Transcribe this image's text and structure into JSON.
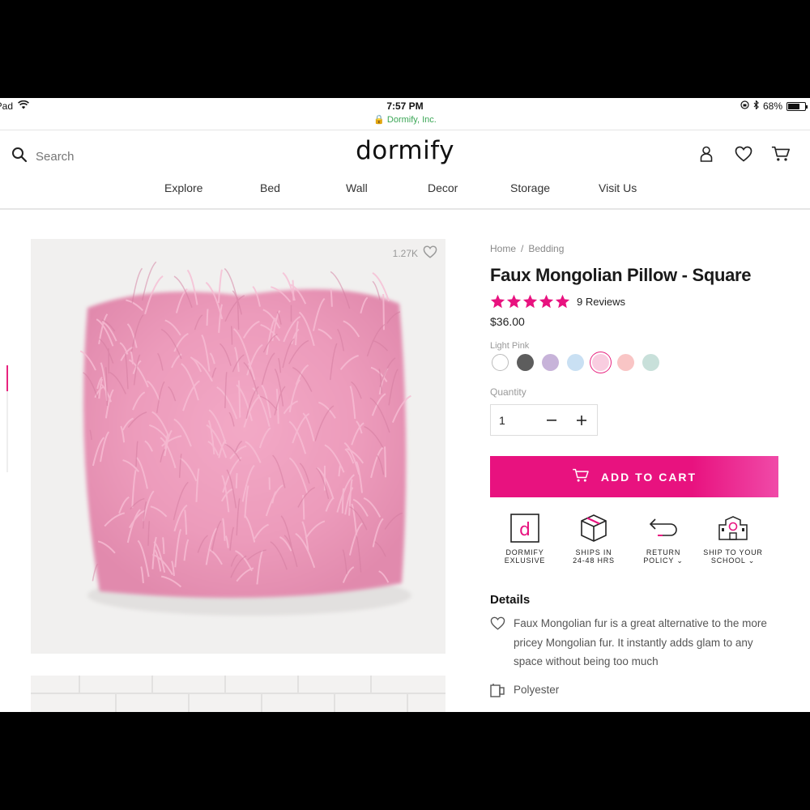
{
  "status_bar": {
    "device": "iPad",
    "time": "7:57 PM",
    "site": "Dormify, Inc.",
    "battery": "68%",
    "battery_level": 0.68
  },
  "header": {
    "search_placeholder": "Search",
    "logo": "dormify",
    "nav": [
      "Explore",
      "Bed",
      "Wall",
      "Decor",
      "Storage",
      "Visit Us"
    ],
    "icons": [
      "account-icon",
      "heart-icon",
      "cart-icon"
    ]
  },
  "gallery": {
    "like_count": "1.27K"
  },
  "product": {
    "breadcrumb": [
      "Home",
      "Bedding"
    ],
    "title": "Faux Mongolian Pillow - Square",
    "rating": 5,
    "reviews": "9 Reviews",
    "price": "$36.00",
    "selected_color": "Light Pink",
    "swatches": [
      "#ffffff",
      "#5d5d5d",
      "#c7b3d9",
      "#c9e0f3",
      "#f9cde0",
      "#f9c5c5",
      "#c8e0da"
    ],
    "swatch_selected_index": 4,
    "quantity_label": "Quantity",
    "quantity": "1",
    "add_to_cart": "ADD TO CART",
    "accent": "#e8127f"
  },
  "badges": [
    {
      "line1": "DORMIFY",
      "line2": "EXLUSIVE",
      "icon": "dormify-d-icon"
    },
    {
      "line1": "SHIPS IN",
      "line2": "24-48 HRS",
      "icon": "box-icon"
    },
    {
      "line1": "RETURN",
      "line2": "POLICY",
      "icon": "return-arrow-icon"
    },
    {
      "line1": "SHIP TO YOUR",
      "line2": "SCHOOL",
      "icon": "school-icon"
    }
  ],
  "details": {
    "title": "Details",
    "description": "Faux Mongolian fur is a great alternative to the more pricey Mongolian fur. It instantly adds glam to any space without being too much",
    "material": "Polyester"
  }
}
